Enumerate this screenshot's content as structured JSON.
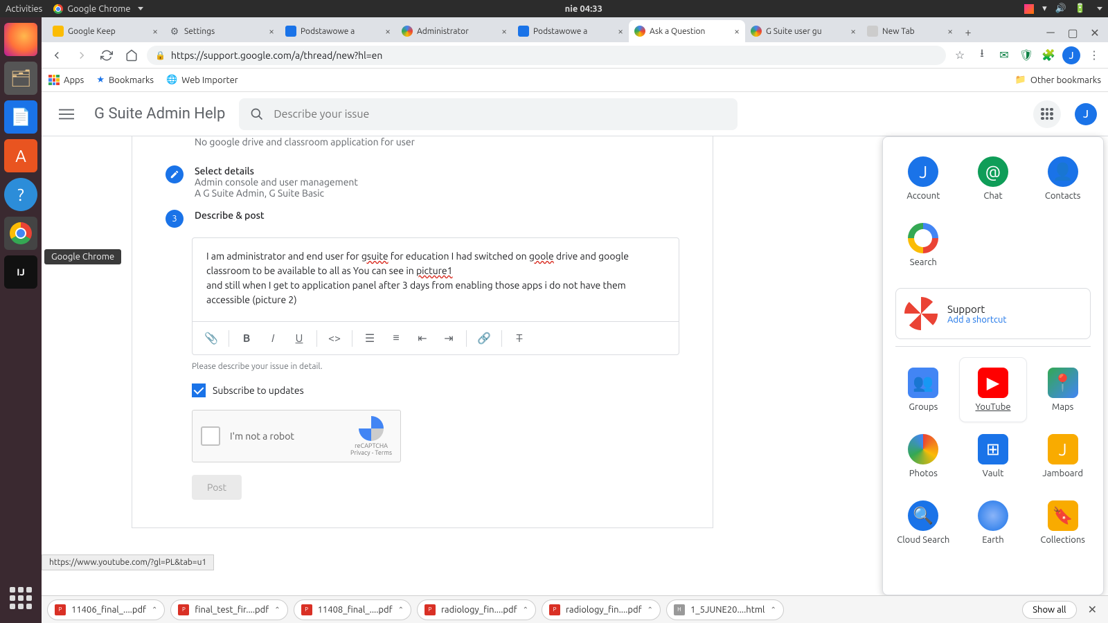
{
  "ubuntu": {
    "activities": "Activities",
    "app": "Google Chrome",
    "clock": "nie 04:33",
    "tooltip": "Google Chrome"
  },
  "tabs": [
    {
      "label": "Google Keep",
      "active": false,
      "fav": "#fbbc04"
    },
    {
      "label": "Settings",
      "active": false,
      "fav": "#5f6368"
    },
    {
      "label": "Podstawowe a",
      "active": false,
      "fav": "#1a73e8"
    },
    {
      "label": "Administrator",
      "active": false,
      "fav": "#4285f4"
    },
    {
      "label": "Podstawowe a",
      "active": false,
      "fav": "#1a73e8"
    },
    {
      "label": "Ask a Question",
      "active": true,
      "fav": "#4285f4"
    },
    {
      "label": "G Suite user gu",
      "active": false,
      "fav": "#4285f4"
    },
    {
      "label": "New Tab",
      "active": false,
      "fav": "#ccc"
    }
  ],
  "omnibox": {
    "url": "https://support.google.com/a/thread/new?hl=en"
  },
  "bookmarks": {
    "apps": "Apps",
    "bookmarks": "Bookmarks",
    "webimporter": "Web Importer",
    "other": "Other bookmarks"
  },
  "help": {
    "title": "G Suite Admin Help",
    "search_placeholder": "Describe your issue"
  },
  "step1": {
    "sub": "No google drive and classroom application for user"
  },
  "step2": {
    "title": "Select details",
    "line1": "Admin console and user management",
    "line2": "A G Suite Admin, G Suite Basic"
  },
  "step3": {
    "title": "Describe & post"
  },
  "editor": {
    "text_before_gsuite": "I am administrator and end user for ",
    "gsuite": "gsuite",
    "text_mid1": " for education I had switched on ",
    "goole": "goole",
    "text_mid2": " drive and google classroom to be available to all as You can see in ",
    "picture1": "picture1",
    "line2": "and still when I get to application panel after 3 days from enabling those apps i do not have them accessible (picture 2)"
  },
  "hint": "Please describe your issue in detail.",
  "subscribe_label": "Subscribe to updates",
  "recaptcha": {
    "label": "I'm not a robot",
    "brand": "reCAPTCHA",
    "legal": "Privacy - Terms"
  },
  "post_label": "Post",
  "apps_panel": {
    "row1": [
      {
        "name": "Account",
        "bg": "#1a73e8",
        "letter": "J"
      },
      {
        "name": "Chat",
        "bg": "#0f9d58",
        "letter": "@"
      },
      {
        "name": "Contacts",
        "bg": "#1a73e8",
        "letter": "👤"
      }
    ],
    "search": {
      "name": "Search"
    },
    "support": {
      "title": "Support",
      "link": "Add a shortcut"
    },
    "row2": [
      {
        "name": "Groups",
        "bg": "#4285f4",
        "letter": "👥"
      },
      {
        "name": "YouTube",
        "bg": "#ff0000",
        "letter": "▶",
        "selected": true
      },
      {
        "name": "Maps",
        "bg": "#34a853",
        "letter": "📍"
      }
    ],
    "row3": [
      {
        "name": "Photos",
        "bg": "#fff",
        "letter": "✿"
      },
      {
        "name": "Vault",
        "bg": "#1a73e8",
        "letter": "⊞"
      },
      {
        "name": "Jamboard",
        "bg": "#f9ab00",
        "letter": "J"
      }
    ],
    "row4": [
      {
        "name": "Cloud Search",
        "bg": "#1a73e8",
        "letter": "🔍"
      },
      {
        "name": "Earth",
        "bg": "#4285f4",
        "letter": "🌐"
      },
      {
        "name": "Collections",
        "bg": "#f9ab00",
        "letter": "🔖"
      }
    ]
  },
  "status_url": "https://www.youtube.com/?gl=PL&tab=u1",
  "downloads": {
    "items": [
      {
        "name": "11406_final_....pdf",
        "type": "pdf"
      },
      {
        "name": "final_test_fir....pdf",
        "type": "pdf"
      },
      {
        "name": "11408_final_....pdf",
        "type": "pdf"
      },
      {
        "name": "radiology_fin....pdf",
        "type": "pdf"
      },
      {
        "name": "radiology_fin....pdf",
        "type": "pdf"
      },
      {
        "name": "1_5JUNE20....html",
        "type": "html"
      }
    ],
    "showall": "Show all"
  }
}
